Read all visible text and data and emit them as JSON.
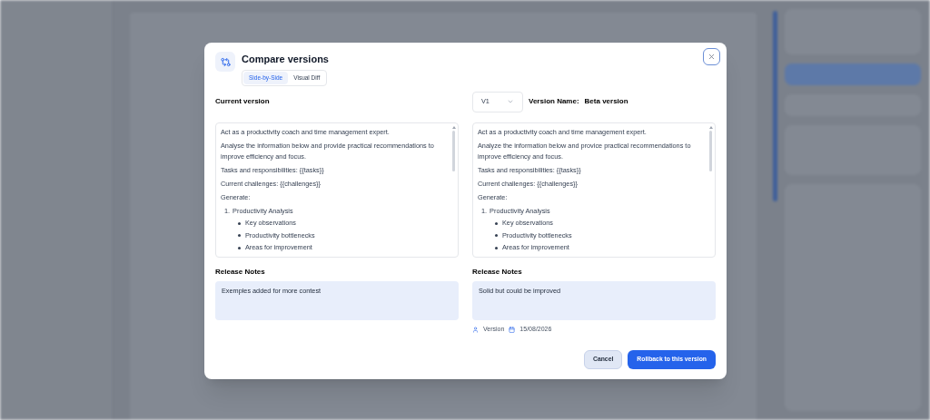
{
  "dialog": {
    "title": "Compare versions",
    "tabs": [
      {
        "label": "Side-by-Side",
        "selected": true
      },
      {
        "label": "Visual Diff",
        "selected": false
      }
    ],
    "current": {
      "heading": "Current version",
      "content": [
        {
          "kind": "paragraph",
          "text": "Act as a productivity coach and time management expert."
        },
        {
          "kind": "paragraph",
          "text": "Analyse the information below and provide practical recommendations to improve efficiency and focus."
        },
        {
          "kind": "paragraph",
          "text": "Tasks and responsibilities: {{tasks}}"
        },
        {
          "kind": "paragraph",
          "text": "Current challenges: {{challenges}}"
        },
        {
          "kind": "paragraph",
          "text": "Generate:"
        },
        {
          "kind": "numbered",
          "marker": "1.",
          "text": "Productivity Analysis",
          "children": [
            {
              "text": "Key observations"
            },
            {
              "text": "Productivity bottlenecks"
            },
            {
              "text": "Areas for improvement"
            }
          ]
        }
      ],
      "notes_heading": "Release Notes",
      "notes": "Exemples added for more contest"
    },
    "compare": {
      "version_select": "V1",
      "version_name_label": "Version Name:",
      "version_name": "Beta version",
      "content": [
        {
          "kind": "paragraph",
          "text": "Act as a productivity coach and time management expert."
        },
        {
          "kind": "paragraph",
          "text": "Analyze the information below and provice practical recommendations to improve efficiency and focus."
        },
        {
          "kind": "paragraph",
          "text": "Tasks and responsibilities: {{tasks}}"
        },
        {
          "kind": "paragraph",
          "text": "Current challenges: {{challenges}}"
        },
        {
          "kind": "paragraph",
          "text": "Generate:"
        },
        {
          "kind": "numbered",
          "marker": "1.",
          "text": "Productivity Analysis",
          "children": [
            {
              "text": "Key observations"
            },
            {
              "text": "Productivity bottlenecks"
            },
            {
              "text": "Areas for improvement"
            }
          ]
        }
      ],
      "notes_heading": "Release Notes",
      "notes": "Solid but could be improved",
      "author": "Version",
      "date": "15/08/2026"
    },
    "buttons": [
      {
        "kind": "secondary",
        "label": "Cancel"
      },
      {
        "kind": "primary",
        "label": "Rollback to this version"
      }
    ]
  }
}
